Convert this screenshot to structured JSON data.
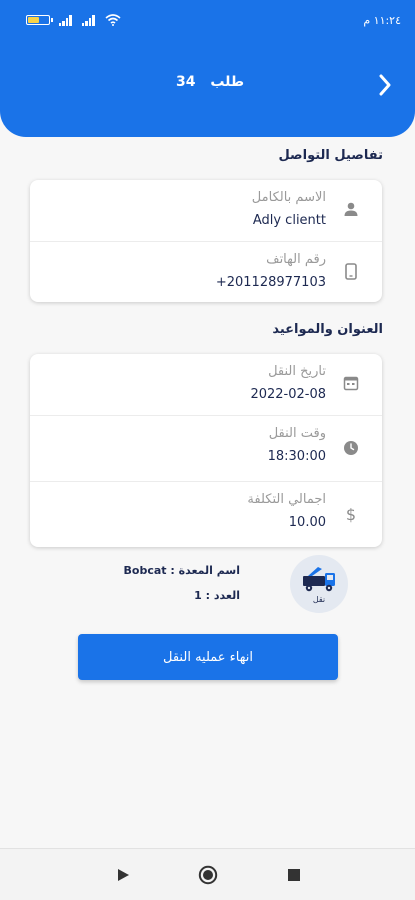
{
  "status_bar": {
    "time": "١١:٢٤ م",
    "battery_level": 0.6,
    "icons": [
      "battery-icon",
      "signal-icon",
      "signal-icon",
      "wifi-icon"
    ]
  },
  "header": {
    "title": "طلب",
    "order_number": "34",
    "back_icon": "chevron-right-icon"
  },
  "contact": {
    "section_title": "تفاصيل التواصل",
    "name_label": "الاسم بالكامل",
    "name_value": "Adly clientt",
    "phone_label": "رقم الهاتف",
    "phone_value": "+201128977103"
  },
  "schedule": {
    "section_title": "العنوان والمواعيد",
    "date_label": "تاريخ النقل",
    "date_value": "2022-02-08",
    "time_label": "وقت النقل",
    "time_value": "18:30:00",
    "cost_label": "اجمالي التكلفة",
    "cost_value": "10.00"
  },
  "equipment": {
    "name_line": "اسم المعدة : Bobcat",
    "count_line": "العدد : 1",
    "icon_caption": "نقل"
  },
  "actions": {
    "finish_label": "انهاء عمليه النقل"
  },
  "colors": {
    "primary": "#1a73e8",
    "dark_text": "#1d2951",
    "muted_text": "#9a9a9a"
  }
}
